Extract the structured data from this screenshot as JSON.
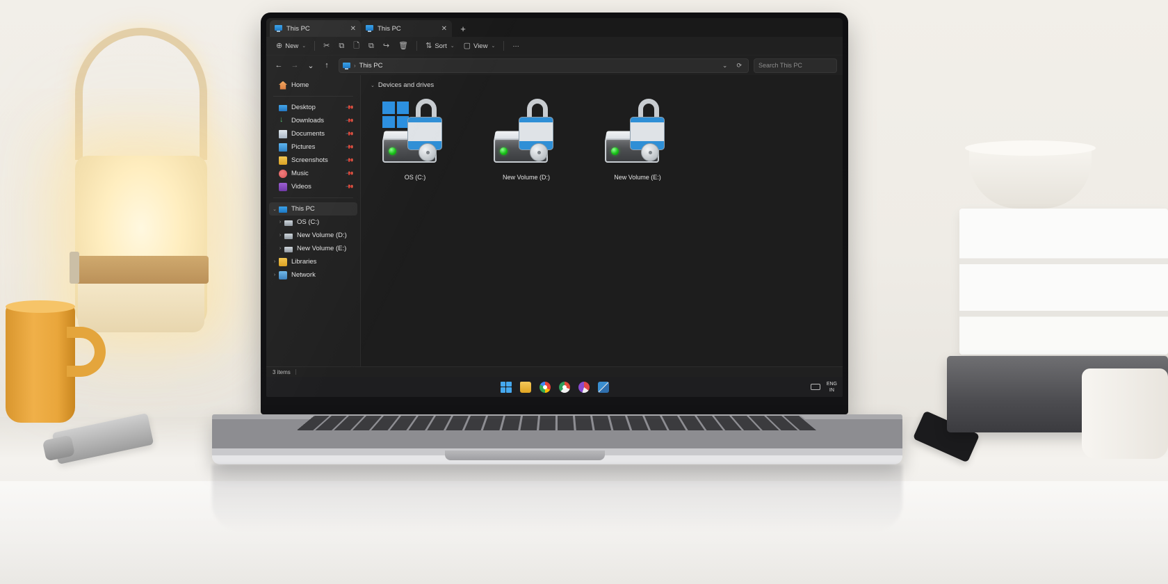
{
  "window": {
    "app_name": "File Explorer",
    "tabs": [
      {
        "title": "This PC",
        "icon": "monitor-icon",
        "close": "✕",
        "active": true
      },
      {
        "title": "This PC",
        "icon": "monitor-icon",
        "close": "✕",
        "active": false
      }
    ],
    "new_tab_label": "+"
  },
  "toolbar": {
    "new_label": "New",
    "new_icon": "⊕",
    "chevron": "⌄",
    "cut_icon": "✂",
    "copy_icon": "⧉",
    "paste_icon": "🗋",
    "rename_icon": "⧉",
    "share_icon": "↪",
    "delete_icon": "🗑",
    "sort_label": "Sort",
    "sort_icon": "⇅",
    "view_label": "View",
    "view_icon": "▢",
    "more_label": "···"
  },
  "addressbar": {
    "back_icon": "←",
    "forward_icon": "→",
    "recent_icon": "⌄",
    "up_icon": "↑",
    "crumb_icon": "monitor-icon",
    "crumb_sep": "›",
    "crumb_text": "This PC",
    "dropdown_icon": "⌄",
    "refresh_icon": "⟳",
    "search_placeholder": "Search This PC",
    "search_value": ""
  },
  "navpane": {
    "groups": [
      {
        "items": [
          {
            "label": "Home",
            "icon": "home-icon",
            "pinned": false,
            "chevron": "",
            "indent": false,
            "selected": false
          }
        ]
      },
      {
        "items": [
          {
            "label": "Desktop",
            "icon": "desktop-icon",
            "pinned": true,
            "chevron": "",
            "indent": false,
            "selected": false
          },
          {
            "label": "Downloads",
            "icon": "downloads-icon",
            "pinned": true,
            "chevron": "",
            "indent": false,
            "selected": false
          },
          {
            "label": "Documents",
            "icon": "documents-icon",
            "pinned": true,
            "chevron": "",
            "indent": false,
            "selected": false
          },
          {
            "label": "Pictures",
            "icon": "pictures-icon",
            "pinned": true,
            "chevron": "",
            "indent": false,
            "selected": false
          },
          {
            "label": "Screenshots",
            "icon": "folder-icon",
            "pinned": true,
            "chevron": "",
            "indent": false,
            "selected": false
          },
          {
            "label": "Music",
            "icon": "music-icon",
            "pinned": true,
            "chevron": "",
            "indent": false,
            "selected": false
          },
          {
            "label": "Videos",
            "icon": "video-icon",
            "pinned": true,
            "chevron": "",
            "indent": false,
            "selected": false
          }
        ]
      },
      {
        "items": [
          {
            "label": "This PC",
            "icon": "pc-icon",
            "pinned": false,
            "chevron": "⌄",
            "indent": false,
            "selected": true
          },
          {
            "label": "OS (C:)",
            "icon": "drive-icon",
            "pinned": false,
            "chevron": "›",
            "indent": true,
            "selected": false
          },
          {
            "label": "New Volume (D:)",
            "icon": "drive-icon",
            "pinned": false,
            "chevron": "›",
            "indent": true,
            "selected": false
          },
          {
            "label": "New Volume (E:)",
            "icon": "drive-icon",
            "pinned": false,
            "chevron": "›",
            "indent": true,
            "selected": false
          },
          {
            "label": "Libraries",
            "icon": "folder-icon",
            "pinned": false,
            "chevron": "›",
            "indent": false,
            "selected": false
          },
          {
            "label": "Network",
            "icon": "network-icon",
            "pinned": false,
            "chevron": "›",
            "indent": false,
            "selected": false
          }
        ]
      }
    ]
  },
  "content": {
    "group_title": "Devices and drives",
    "group_chevron": "⌄",
    "drives": [
      {
        "label": "OS (C:)",
        "icon": "drive-unlocked-icon",
        "has_windows_logo": true,
        "led": "green",
        "lock_state": "unlocked"
      },
      {
        "label": "New Volume (D:)",
        "icon": "drive-unlocked-icon",
        "has_windows_logo": false,
        "led": "green",
        "lock_state": "unlocked"
      },
      {
        "label": "New Volume (E:)",
        "icon": "drive-unlocked-icon",
        "has_windows_logo": false,
        "led": "green",
        "lock_state": "unlocked"
      }
    ]
  },
  "statusbar": {
    "item_count": "3 items"
  },
  "taskbar": {
    "apps": [
      {
        "name": "start-button",
        "icon": "windows-logo-icon"
      },
      {
        "name": "file-explorer-button",
        "icon": "folder-icon"
      },
      {
        "name": "chrome-button",
        "icon": "chrome-icon"
      },
      {
        "name": "chrome-button-2",
        "icon": "chrome-icon"
      },
      {
        "name": "browser-button-3",
        "icon": "browser-icon"
      },
      {
        "name": "snipping-tool-button",
        "icon": "snip-icon"
      }
    ],
    "tray": {
      "keyboard_icon": "keyboard-icon",
      "lang_line1": "ENG",
      "lang_line2": "IN"
    }
  },
  "colors": {
    "accent": "#2f8fd6",
    "window_bg": "#202020",
    "content_bg": "#1d1d1d",
    "led_green": "#19c219"
  }
}
